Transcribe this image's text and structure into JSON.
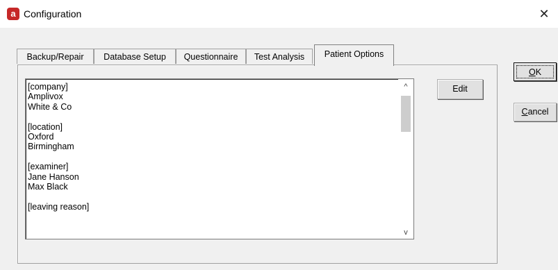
{
  "window": {
    "title": "Configuration",
    "app_icon_letter": "a",
    "close_symbol": "✕"
  },
  "tabs": [
    {
      "label": "Backup/Repair",
      "active": false
    },
    {
      "label": "Database Setup",
      "active": false
    },
    {
      "label": "Questionnaire",
      "active": false
    },
    {
      "label": "Test Analysis",
      "active": false
    },
    {
      "label": "Patient Options",
      "active": true
    }
  ],
  "list": {
    "lines": [
      "[company]",
      "Amplivox",
      "White & Co",
      "",
      "[location]",
      "Oxford",
      "Birmingham",
      "",
      "[examiner]",
      "Jane Hanson",
      "Max Black",
      "",
      "[leaving reason]"
    ],
    "scroll_up_glyph": "^",
    "scroll_down_glyph": "v"
  },
  "buttons": {
    "edit": "Edit",
    "ok_mnemonic": "O",
    "ok_rest": "K",
    "cancel_mnemonic": "C",
    "cancel_rest": "ancel"
  }
}
